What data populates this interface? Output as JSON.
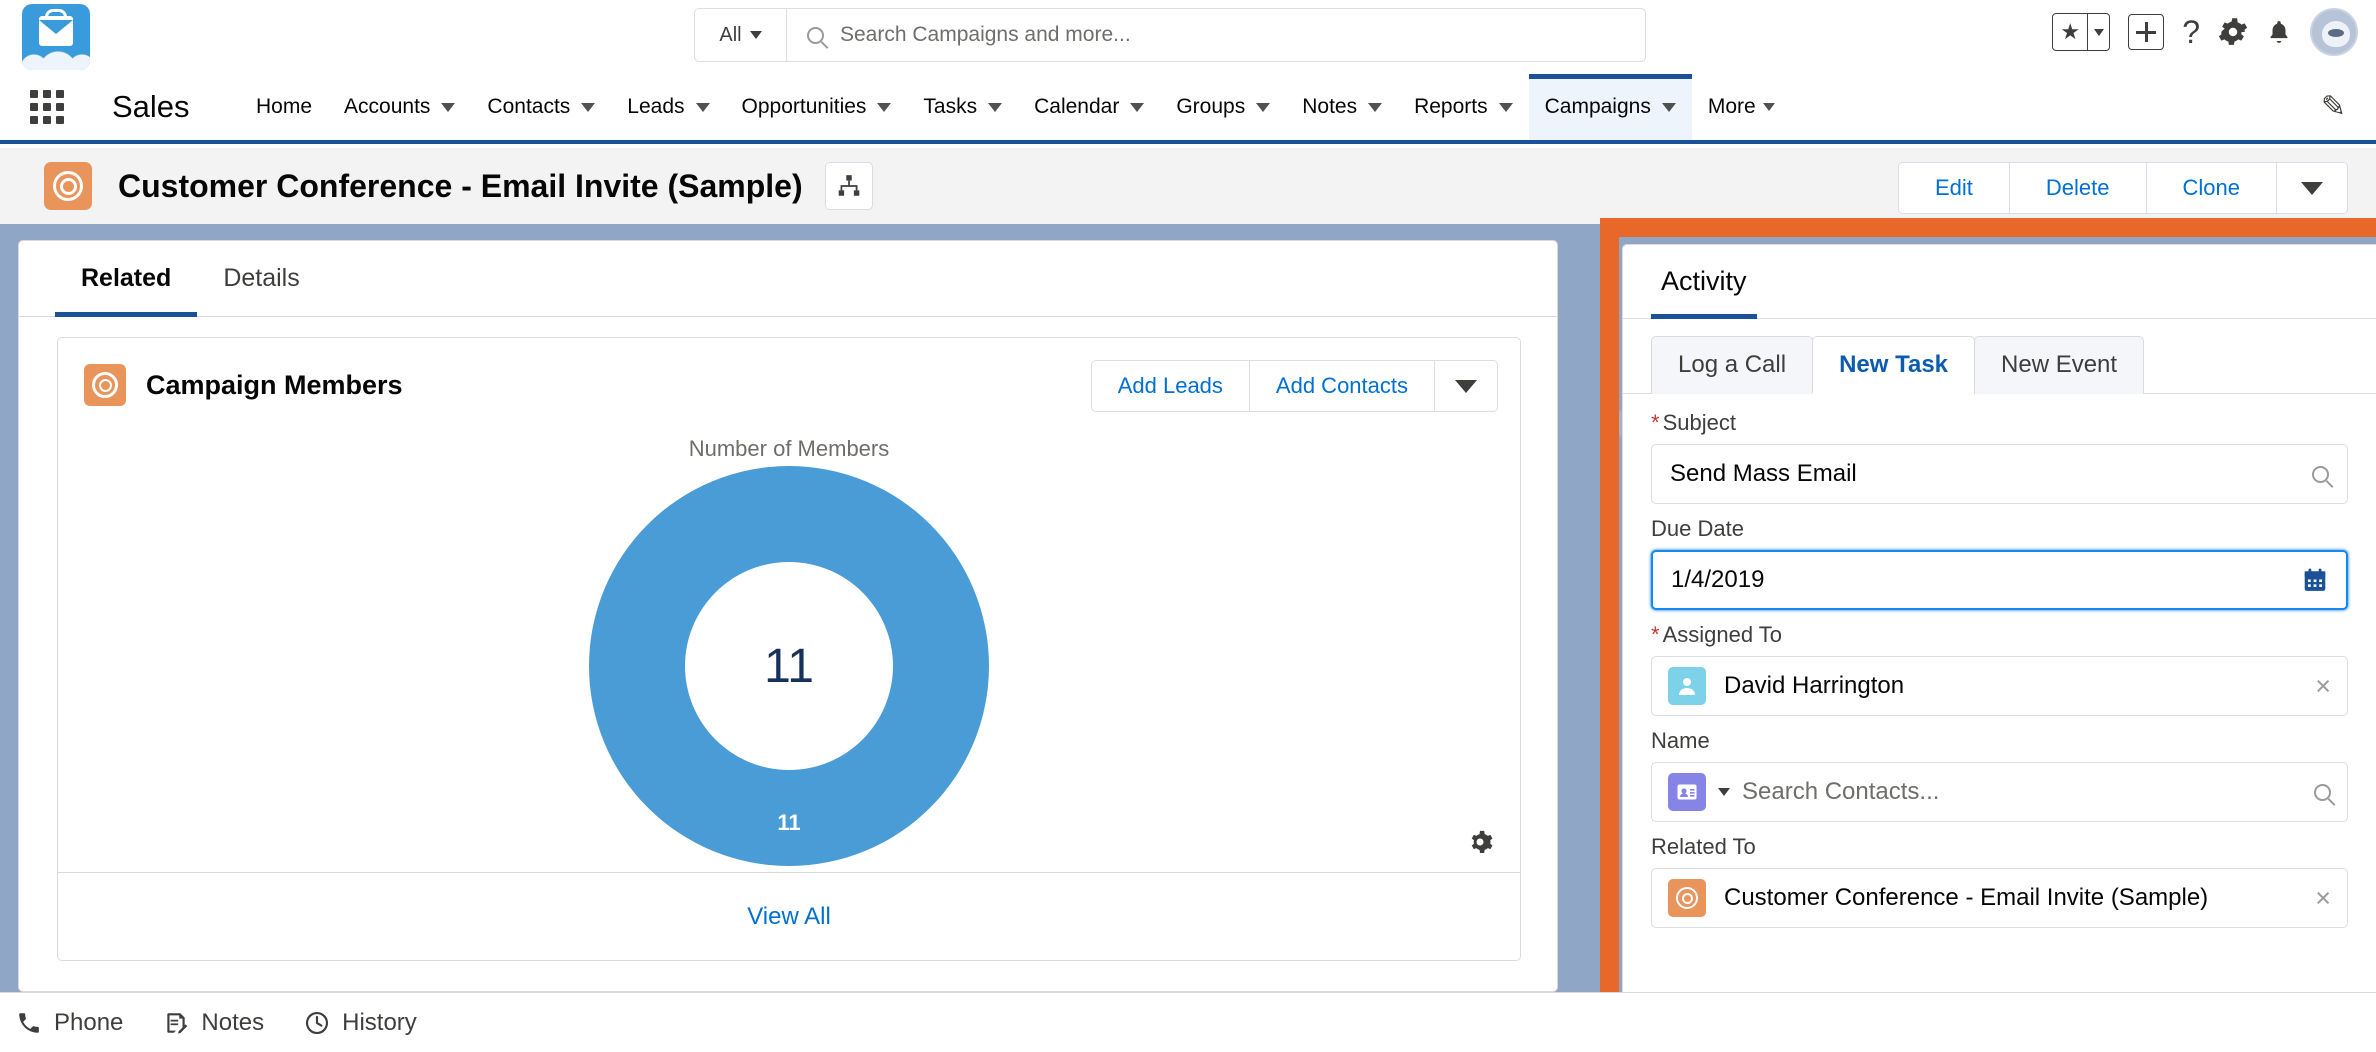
{
  "global_header": {
    "logo_name": "salesforce-cloud-logo",
    "search": {
      "scope": "All",
      "placeholder": "Search Campaigns and more..."
    },
    "icons": [
      "favorites-star-icon",
      "global-actions-plus-icon",
      "help-question-icon",
      "setup-gear-icon",
      "notifications-bell-icon",
      "user-avatar"
    ]
  },
  "app_nav": {
    "app_name": "Sales",
    "items": [
      {
        "label": "Home",
        "has_menu": false,
        "active": false
      },
      {
        "label": "Accounts",
        "has_menu": true,
        "active": false
      },
      {
        "label": "Contacts",
        "has_menu": true,
        "active": false
      },
      {
        "label": "Leads",
        "has_menu": true,
        "active": false
      },
      {
        "label": "Opportunities",
        "has_menu": true,
        "active": false
      },
      {
        "label": "Tasks",
        "has_menu": true,
        "active": false
      },
      {
        "label": "Calendar",
        "has_menu": true,
        "active": false
      },
      {
        "label": "Groups",
        "has_menu": true,
        "active": false
      },
      {
        "label": "Notes",
        "has_menu": true,
        "active": false
      },
      {
        "label": "Reports",
        "has_menu": true,
        "active": false
      },
      {
        "label": "Campaigns",
        "has_menu": true,
        "active": true
      },
      {
        "label": "More",
        "has_menu": true,
        "active": false
      }
    ]
  },
  "record_header": {
    "icon": "campaign-target-icon",
    "title": "Customer Conference - Email Invite (Sample)",
    "hierarchy_button": "campaign-hierarchy-icon",
    "actions": [
      "Edit",
      "Delete",
      "Clone"
    ]
  },
  "record_tabs": [
    {
      "label": "Related",
      "active": true
    },
    {
      "label": "Details",
      "active": false
    }
  ],
  "campaign_members": {
    "title": "Campaign Members",
    "buttons": [
      "Add Leads",
      "Add Contacts"
    ],
    "view_all": "View All",
    "gear": "chart-settings-gear-icon"
  },
  "chart_data": {
    "type": "pie",
    "title": "Number of Members",
    "categories": [
      "Members"
    ],
    "values": [
      11
    ],
    "center_label": "11",
    "data_labels": [
      "11"
    ],
    "colors": [
      "#4a9cd6"
    ],
    "donut": true,
    "legend": "none"
  },
  "activity_panel": {
    "highlight_color": "#E8682A",
    "tab": "Activity",
    "subtabs": [
      {
        "label": "Log a Call",
        "active": false
      },
      {
        "label": "New Task",
        "active": true
      },
      {
        "label": "New Event",
        "active": false
      }
    ],
    "fields": {
      "subject": {
        "label": "Subject",
        "required": true,
        "value": "Send Mass Email",
        "icon": "search-icon"
      },
      "due_date": {
        "label": "Due Date",
        "required": false,
        "value": "1/4/2019",
        "icon": "calendar-icon",
        "focused": true
      },
      "assigned_to": {
        "label": "Assigned To",
        "required": true,
        "value": "David Harrington",
        "icon": "user-icon",
        "clear": "×"
      },
      "name": {
        "label": "Name",
        "required": false,
        "placeholder": "Search Contacts...",
        "icon": "contact-card-icon",
        "search": "search-icon"
      },
      "related_to": {
        "label": "Related To",
        "required": false,
        "value": "Customer Conference - Email Invite (Sample)",
        "icon": "campaign-target-icon",
        "clear": "×"
      }
    }
  },
  "utility_bar": [
    {
      "label": "Phone",
      "icon": "phone-icon"
    },
    {
      "label": "Notes",
      "icon": "notes-icon"
    },
    {
      "label": "History",
      "icon": "history-clock-icon"
    }
  ]
}
